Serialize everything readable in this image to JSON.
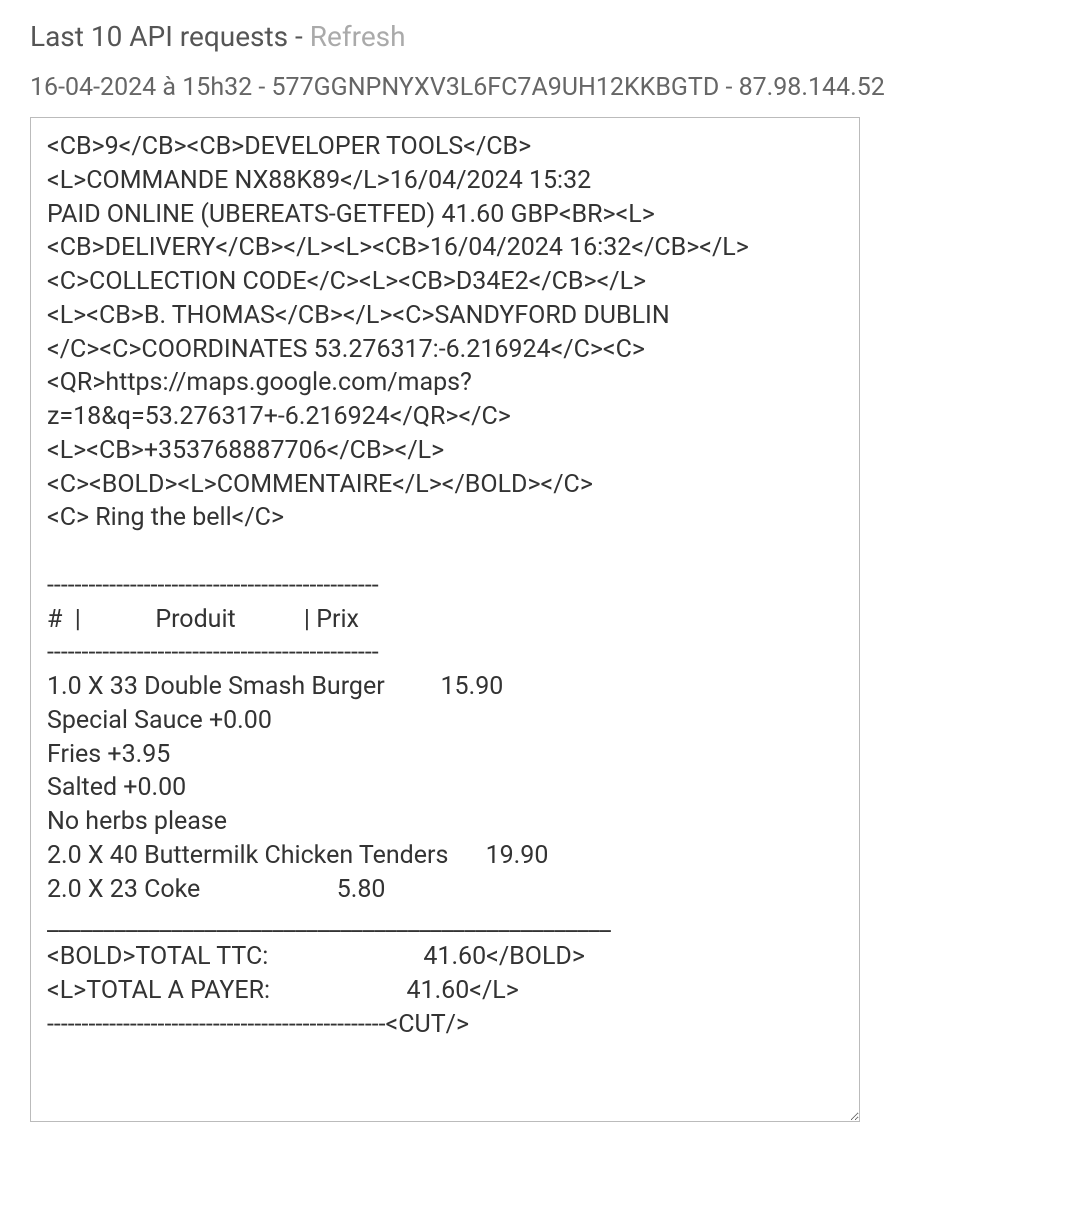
{
  "heading": {
    "title": "Last 10 API requests - ",
    "refresh_label": "Refresh"
  },
  "subheading": "16-04-2024 à 15h32 - 577GGNPNYXV3L6FC7A9UH12KKBGTD - 87.98.144.52",
  "receipt_text": "<CB>9</CB><CB>DEVELOPER TOOLS</CB>\n<L>COMMANDE NX88K89</L>16/04/2024 15:32\nPAID ONLINE (UBEREATS-GETFED) 41.60 GBP<BR><L><CB>DELIVERY</CB></L><L><CB>16/04/2024 16:32</CB></L>\n<C>COLLECTION CODE</C><L><CB>D34E2</CB></L>\n<L><CB>B. THOMAS</CB></L><C>SANDYFORD DUBLIN\n</C><C>COORDINATES 53.276317:-6.216924</C><C>\n<QR>https://maps.google.com/maps?z=18&q=53.276317+-6.216924</QR></C>\n<L><CB>+353768887706</CB></L>\n<C><BOLD><L>COMMENTAIRE</L></BOLD></C>\n<C> Ring the bell</C>\n\n------------------------------------------------\n#  |            Produit           | Prix\n------------------------------------------------\n1.0 X 33 Double Smash Burger         15.90\nSpecial Sauce +0.00\nFries +3.95\nSalted +0.00\nNo herbs please\n2.0 X 40 Buttermilk Chicken Tenders      19.90\n2.0 X 23 Coke                      5.80\n__________________________________________________\n<BOLD>TOTAL TTC:                         41.60</BOLD>\n<L>TOTAL A PAYER:                      41.60</L>\n-------------------------------------------------<CUT/>"
}
